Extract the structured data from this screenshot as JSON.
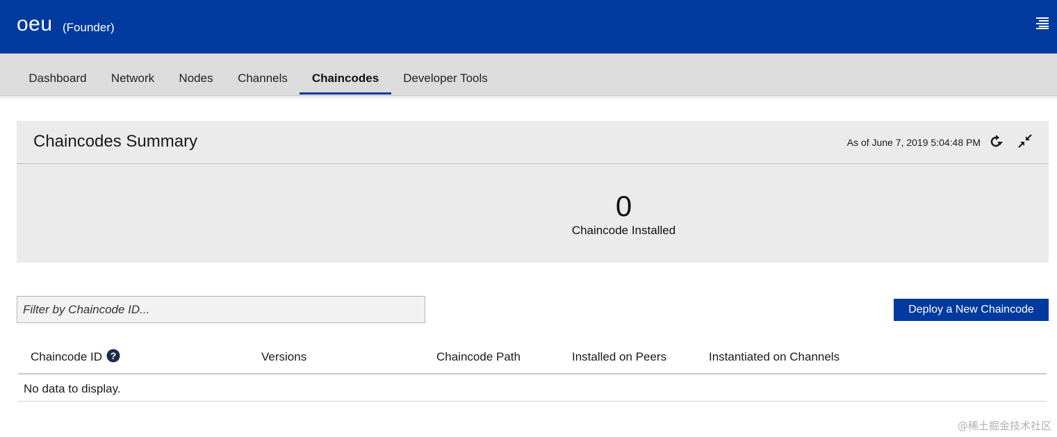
{
  "header": {
    "brand": "oeu",
    "role": "(Founder)",
    "menu_icon": "hamburger-menu-icon"
  },
  "nav": {
    "tabs": [
      {
        "label": "Dashboard",
        "active": false
      },
      {
        "label": "Network",
        "active": false
      },
      {
        "label": "Nodes",
        "active": false
      },
      {
        "label": "Channels",
        "active": false
      },
      {
        "label": "Chaincodes",
        "active": true
      },
      {
        "label": "Developer Tools",
        "active": false
      }
    ]
  },
  "summary": {
    "title": "Chaincodes Summary",
    "timestamp": "As of June 7, 2019 5:04:48 PM",
    "refresh_icon": "refresh-icon",
    "collapse_icon": "collapse-icon",
    "count": "0",
    "count_label": "Chaincode Installed"
  },
  "filter": {
    "placeholder": "Filter by Chaincode ID..."
  },
  "actions": {
    "deploy_label": "Deploy a New Chaincode"
  },
  "table": {
    "columns": [
      "Chaincode ID",
      "Versions",
      "Chaincode Path",
      "Installed on Peers",
      "Instantiated on Channels"
    ],
    "help_icon": "help-icon",
    "empty_message": "No data to display."
  },
  "watermark": "@稀土掘金技术社区",
  "colors": {
    "brand_blue": "#003a9e",
    "nav_bg": "#dcdcdd",
    "card_bg": "#ebebeb"
  }
}
